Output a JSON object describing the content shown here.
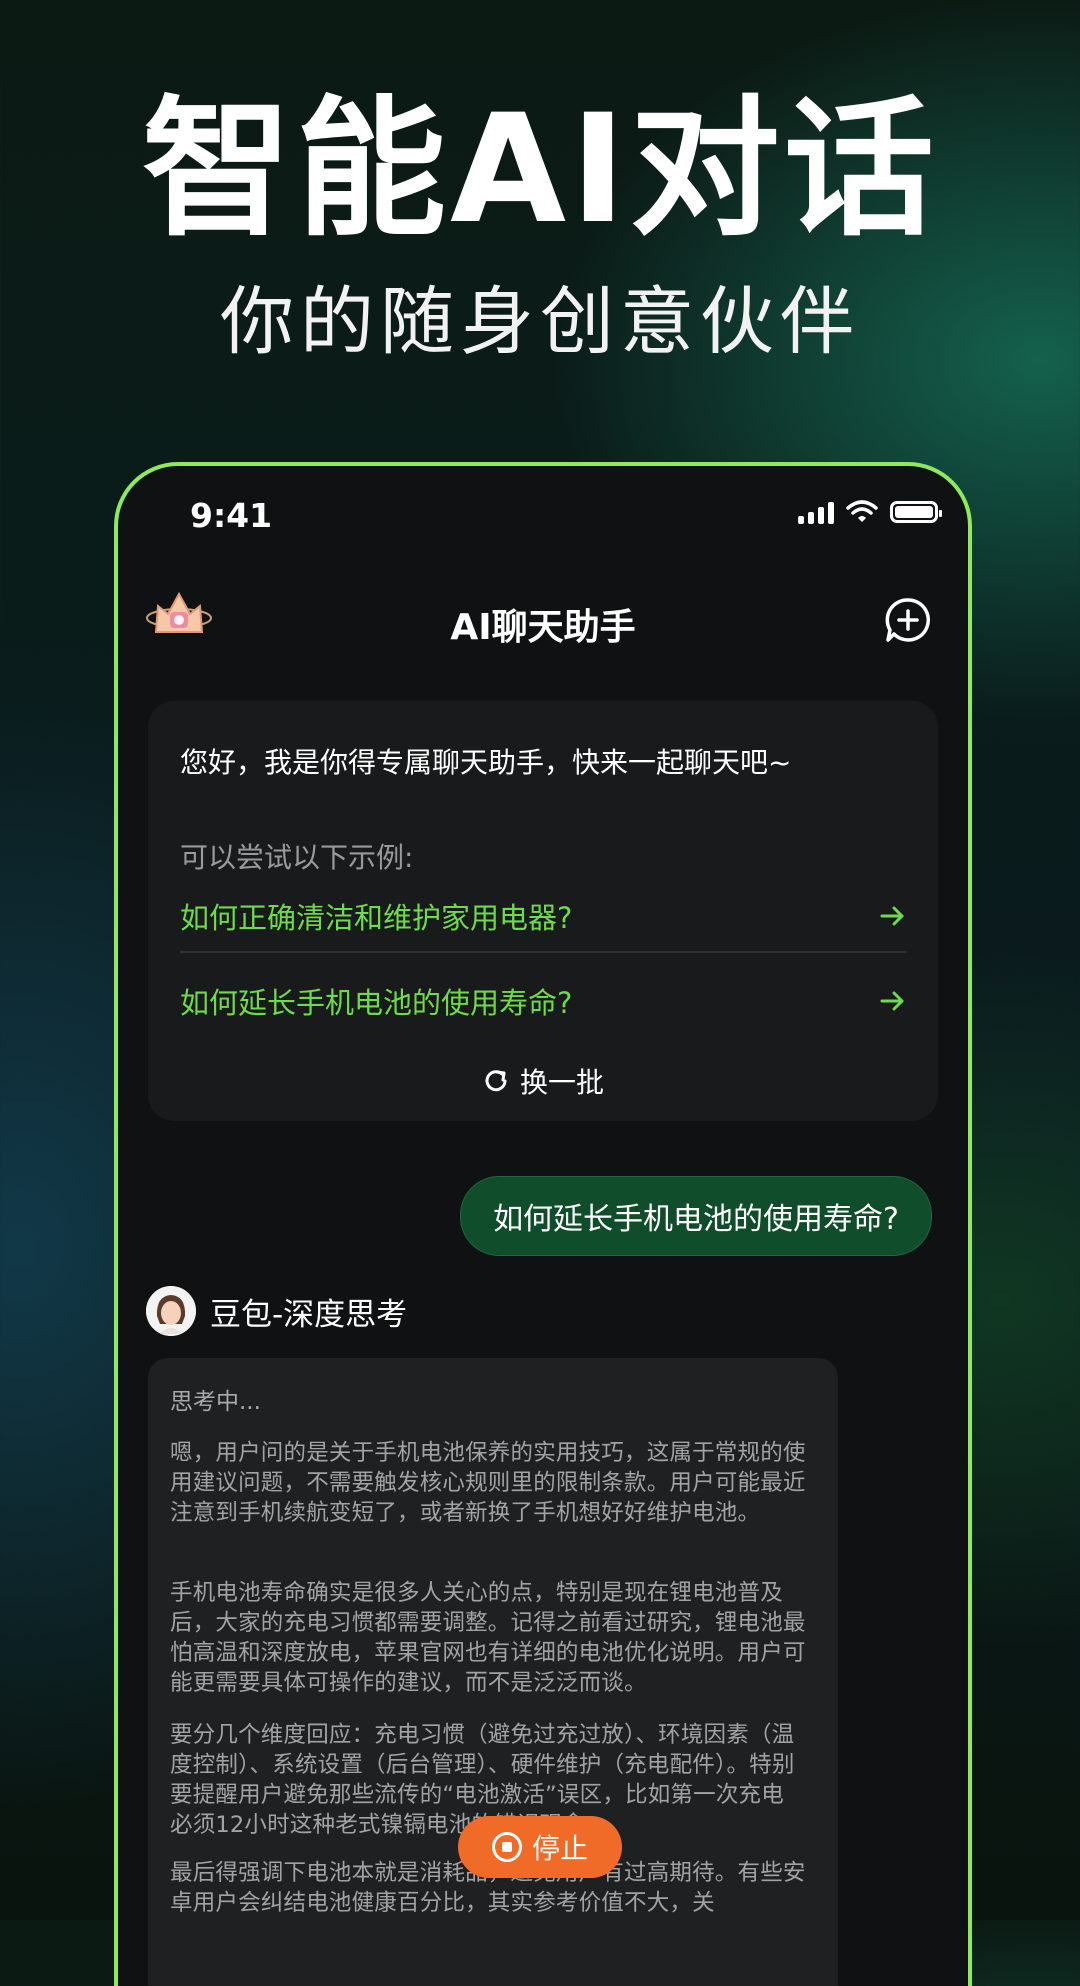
{
  "hero": {
    "title": "智能AI对话",
    "subtitle": "你的随身创意伙伴"
  },
  "status_bar": {
    "time": "9:41"
  },
  "navbar": {
    "title": "AI聊天助手"
  },
  "intro": {
    "greeting": "您好，我是你得专属聊天助手，快来一起聊天吧~",
    "try_label": "可以尝试以下示例:",
    "examples": [
      "如何正确清洁和维护家用电器?",
      "如何延长手机电池的使用寿命?"
    ],
    "refresh_label": "换一批"
  },
  "chat": {
    "user_message": "如何延长手机电池的使用寿命?",
    "bot_name": "豆包-深度思考",
    "thinking_label": "思考中...",
    "paragraphs": [
      "嗯，用户问的是关于手机电池保养的实用技巧，这属于常规的使用建议问题，不需要触发核心规则里的限制条款。用户可能最近注意到手机续航变短了，或者新换了手机想好好维护电池。",
      "手机电池寿命确实是很多人关心的点，特别是现在锂电池普及后，大家的充电习惯都需要调整。记得之前看过研究，锂电池最怕高温和深度放电，苹果官网也有详细的电池优化说明。用户可能更需要具体可操作的建议，而不是泛泛而谈。",
      "要分几个维度回应：充电习惯（避免过充过放）、环境因素（温度控制）、系统设置（后台管理）、硬件维护（充电配件）。特别要提醒用户避免那些流传的“电池激活”误区，比如第一次充电必须12小时这种老式镍镉电池的错误观念。",
      "最后得强调下电池本就是消耗品，避免用户有过高期待。有些安卓用户会纠结电池健康百分比，其实参考价值不大，关"
    ],
    "stop_label": "停止"
  },
  "colors": {
    "accent_green": "#6fdb48",
    "frame_green": "#8fea5a",
    "bubble_green": "#0f4d2b",
    "stop_orange": "#f06a28"
  }
}
